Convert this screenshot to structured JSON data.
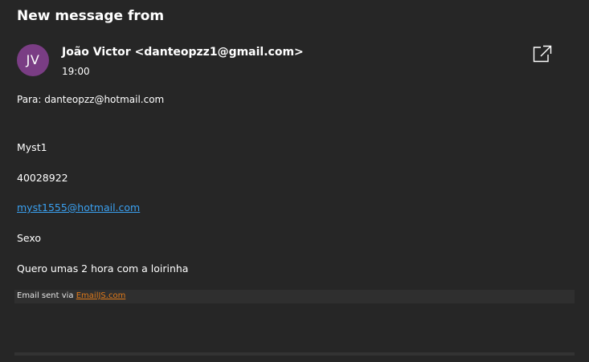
{
  "header": {
    "title": "New message from"
  },
  "message": {
    "avatar_initials": "JV",
    "avatar_color": "#7a3d84",
    "sender": "João Victor <danteopzz1@gmail.com>",
    "time": "19:00",
    "to_label": "Para:",
    "to_address": "danteopzz@hotmail.com",
    "body": {
      "line1": "Myst1",
      "line2": "40028922",
      "email_link": "myst1555@hotmail.com",
      "line4": "Sexo",
      "line5": "Quero umas 2 hora com a loirinha"
    },
    "footer": {
      "prefix": "Email sent via",
      "link": "EmailJS.com"
    }
  },
  "icons": {
    "popout": "open-in-new-window-icon"
  },
  "colors": {
    "background": "#262626",
    "link": "#3aa0f0",
    "footer_link": "#e07a1a"
  }
}
